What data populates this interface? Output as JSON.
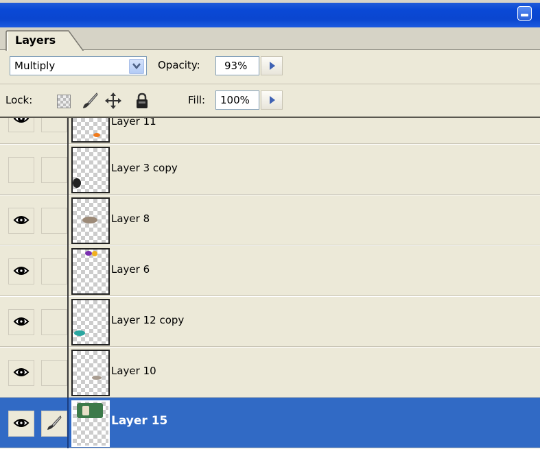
{
  "panel": {
    "tab_label": "Layers"
  },
  "blend": {
    "mode": "Multiply",
    "opacity_label": "Opacity:",
    "opacity_value": "93%"
  },
  "lock": {
    "label": "Lock:",
    "fill_label": "Fill:",
    "fill_value": "100%"
  },
  "icons": [
    "collapse-icon",
    "chevron-down-icon",
    "triangle-right-icon",
    "transparency-lock-icon",
    "brush-icon",
    "move-icon",
    "padlock-icon",
    "eye-icon",
    "brush-link-icon"
  ],
  "colors": {
    "titlebar": "#0a49d6",
    "selection": "#316ac5",
    "panel": "#ece9d8"
  },
  "layers": [
    {
      "name": "Layer 11",
      "visible": true,
      "linked": false,
      "selected": false
    },
    {
      "name": "Layer 3 copy",
      "visible": false,
      "linked": false,
      "selected": false
    },
    {
      "name": "Layer 8",
      "visible": true,
      "linked": false,
      "selected": false
    },
    {
      "name": "Layer 6",
      "visible": true,
      "linked": false,
      "selected": false
    },
    {
      "name": "Layer 12 copy",
      "visible": true,
      "linked": false,
      "selected": false
    },
    {
      "name": "Layer 10",
      "visible": true,
      "linked": false,
      "selected": false
    },
    {
      "name": "Layer 15",
      "visible": true,
      "linked": true,
      "selected": true
    }
  ]
}
